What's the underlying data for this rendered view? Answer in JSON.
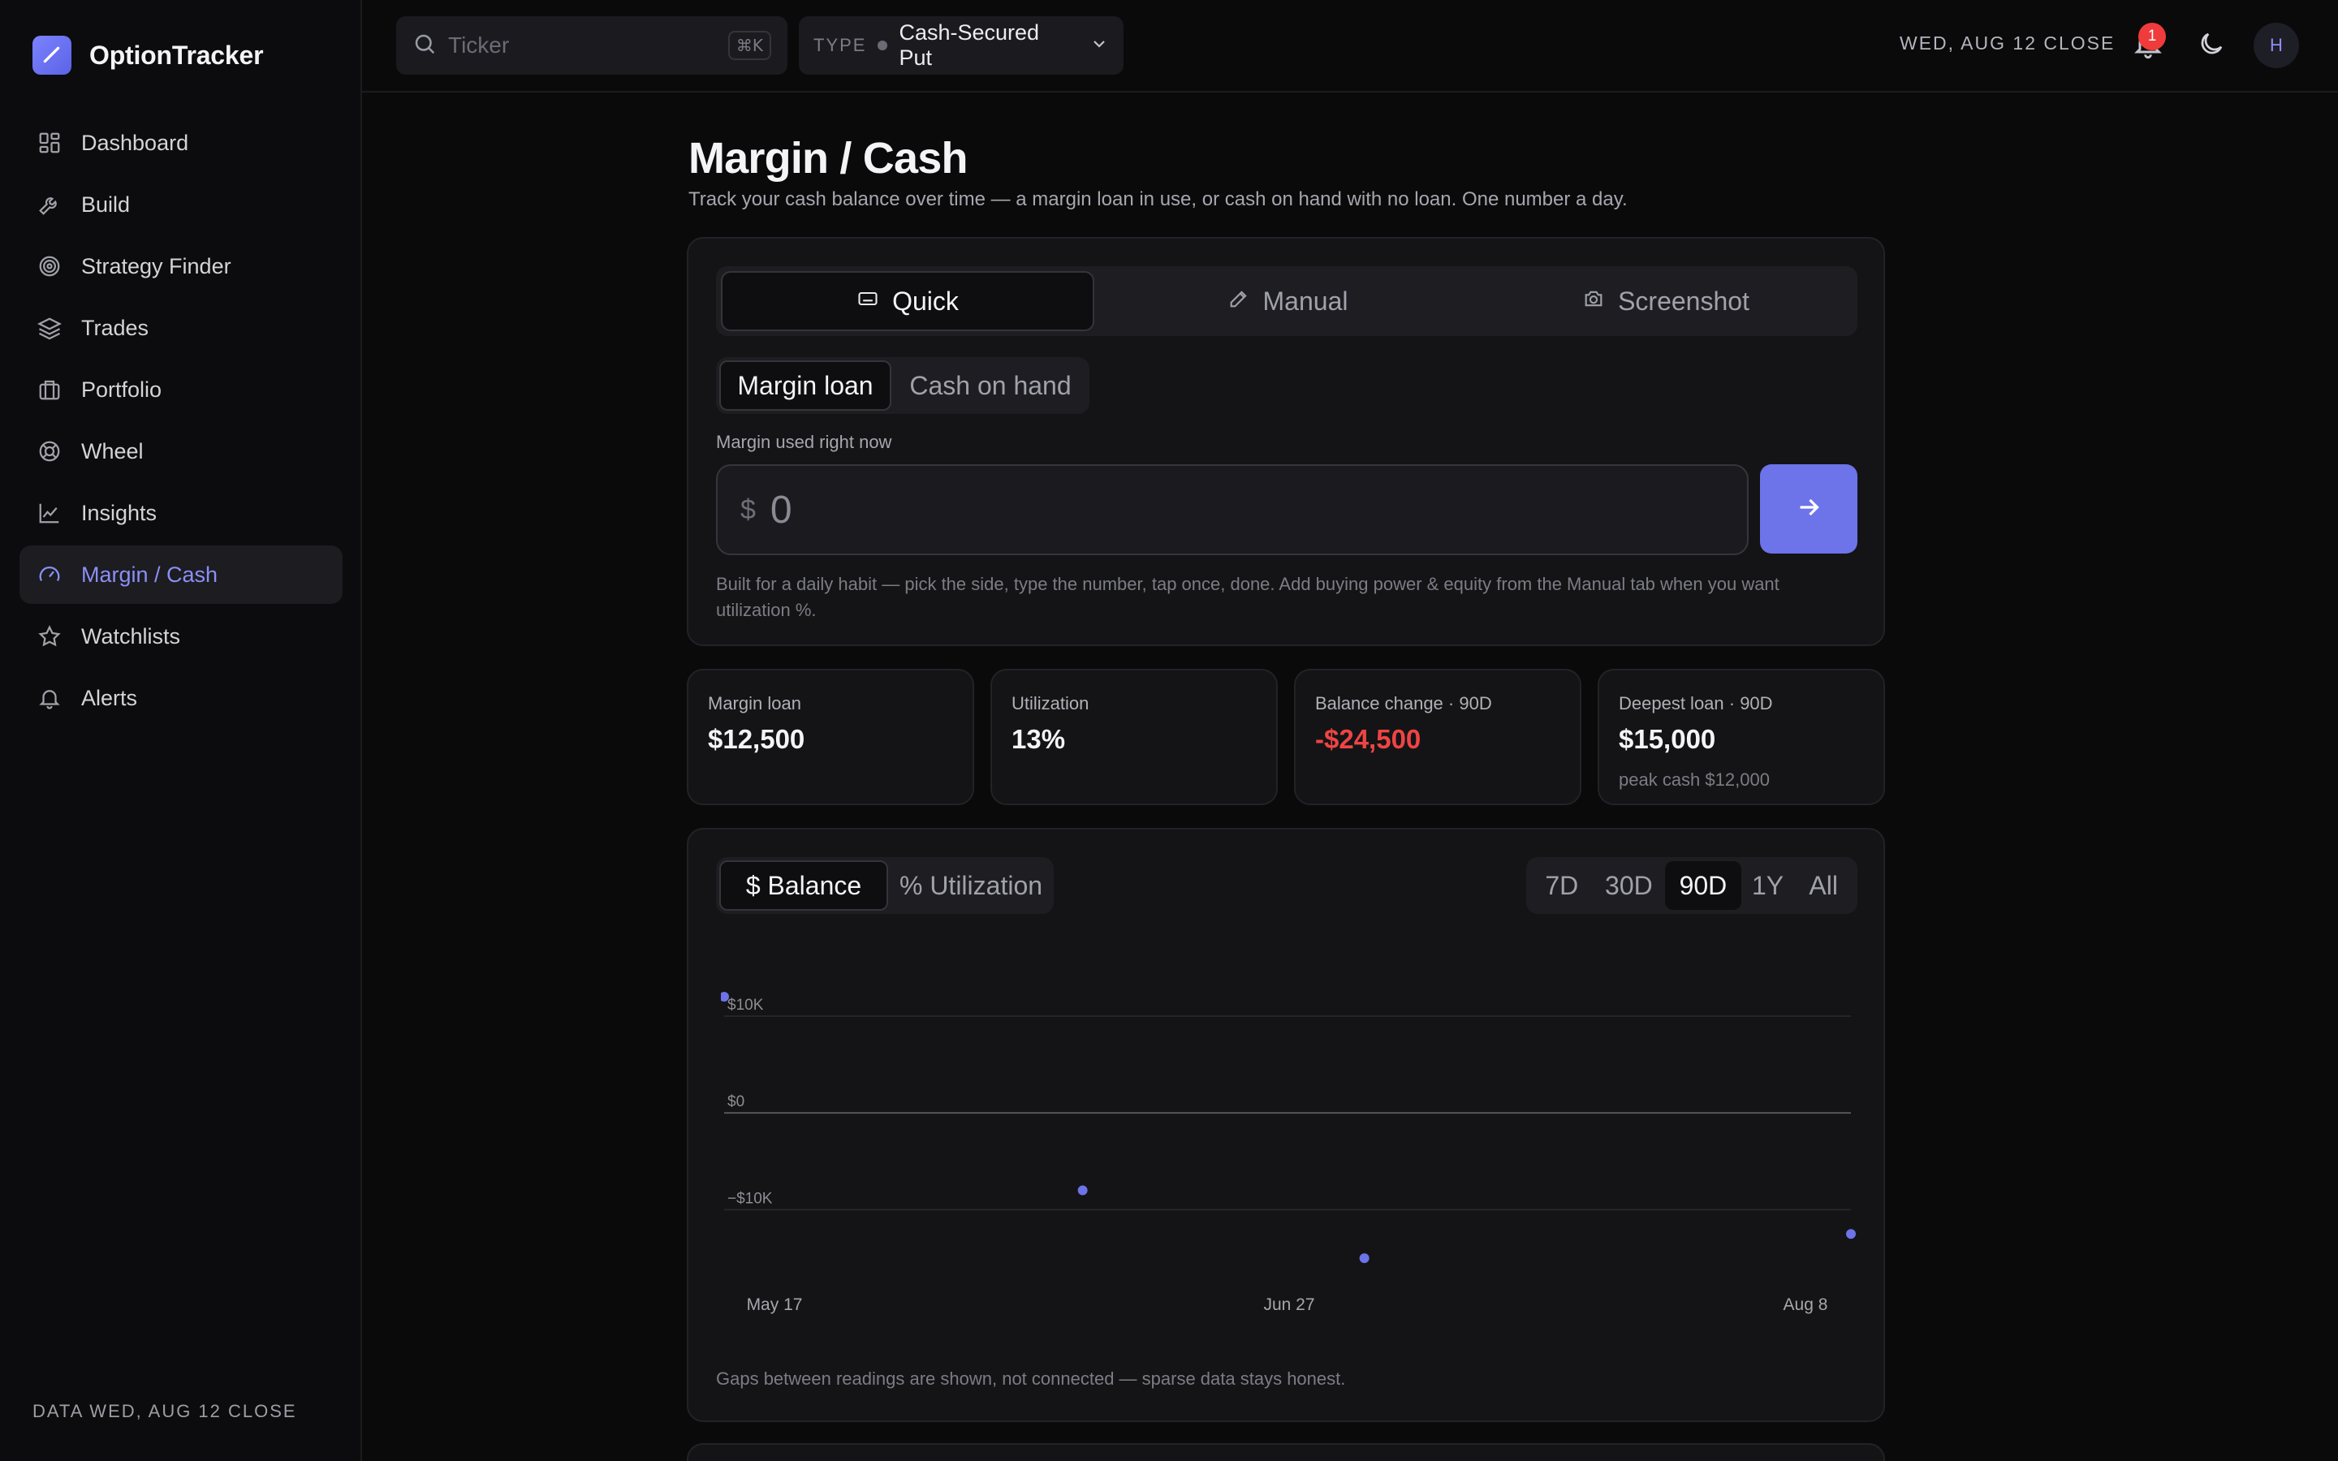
{
  "app": {
    "name": "OptionTracker"
  },
  "sidebar": {
    "items": [
      {
        "label": "Dashboard",
        "icon": "dashboard-grid-icon"
      },
      {
        "label": "Build",
        "icon": "wrench-icon"
      },
      {
        "label": "Strategy Finder",
        "icon": "target-icon"
      },
      {
        "label": "Trades",
        "icon": "layers-icon"
      },
      {
        "label": "Portfolio",
        "icon": "briefcase-icon"
      },
      {
        "label": "Wheel",
        "icon": "lifebuoy-icon"
      },
      {
        "label": "Insights",
        "icon": "line-chart-icon"
      },
      {
        "label": "Margin / Cash",
        "icon": "gauge-icon",
        "active": true
      },
      {
        "label": "Watchlists",
        "icon": "star-icon"
      },
      {
        "label": "Alerts",
        "icon": "bell-icon"
      }
    ],
    "footer": "DATA WED, AUG 12 CLOSE"
  },
  "topbar": {
    "search_placeholder": "Ticker",
    "search_shortcut": "⌘K",
    "type_label": "TYPE",
    "type_value": "Cash-Secured Put",
    "close_date": "WED, AUG 12 CLOSE",
    "notification_count": "1",
    "avatar_initial": "H"
  },
  "page": {
    "title": "Margin / Cash",
    "subtitle": "Track your cash balance over time — a margin loan in use, or cash on hand with no loan. One number a day."
  },
  "entry": {
    "tabs": [
      "Quick",
      "Manual",
      "Screenshot"
    ],
    "active_tab": "Quick",
    "sides": [
      "Margin loan",
      "Cash on hand"
    ],
    "active_side": "Margin loan",
    "field_label": "Margin used right now",
    "currency": "$",
    "amount_placeholder": "0",
    "hint": "Built for a daily habit — pick the side, type the number, tap once, done. Add buying power & equity from the Manual tab when you want utilization %."
  },
  "stats": [
    {
      "label": "Margin loan",
      "value": "$12,500",
      "sub": ""
    },
    {
      "label": "Utilization",
      "value": "13%",
      "sub": ""
    },
    {
      "label": "Balance change · 90D",
      "value": "-$24,500",
      "sub": "",
      "negative": true
    },
    {
      "label": "Deepest loan · 90D",
      "value": "$15,000",
      "sub": "peak cash $12,000"
    }
  ],
  "chart_controls": {
    "modes": [
      "$ Balance",
      "% Utilization"
    ],
    "active_mode": "$ Balance",
    "ranges": [
      "7D",
      "30D",
      "90D",
      "1Y",
      "All"
    ],
    "active_range": "90D"
  },
  "chart_note": "Gaps between readings are shown, not connected — sparse data stays honest.",
  "colors": {
    "accent": "#6d73e8",
    "negative": "#ef4444",
    "badge": "#ef3b3b"
  },
  "chart_data": {
    "type": "scatter",
    "title": "",
    "xlabel": "",
    "ylabel": "",
    "y_tick_labels": [
      "$10K",
      "$0",
      "−$10K"
    ],
    "y_ticks": [
      10000,
      0,
      -10000
    ],
    "x_tick_labels": [
      "May 17",
      "Jun 27",
      "Aug 8"
    ],
    "x_range": [
      "2026-05-16",
      "2026-08-12"
    ],
    "ylim": [
      -16000,
      12500
    ],
    "grid": true,
    "series": [
      {
        "points": [
          {
            "x": "2026-05-16",
            "y": 12000
          },
          {
            "x": "2026-06-13",
            "y": -8000
          },
          {
            "x": "2026-07-05",
            "y": -15000
          },
          {
            "x": "2026-08-12",
            "y": -12500
          }
        ]
      }
    ]
  }
}
